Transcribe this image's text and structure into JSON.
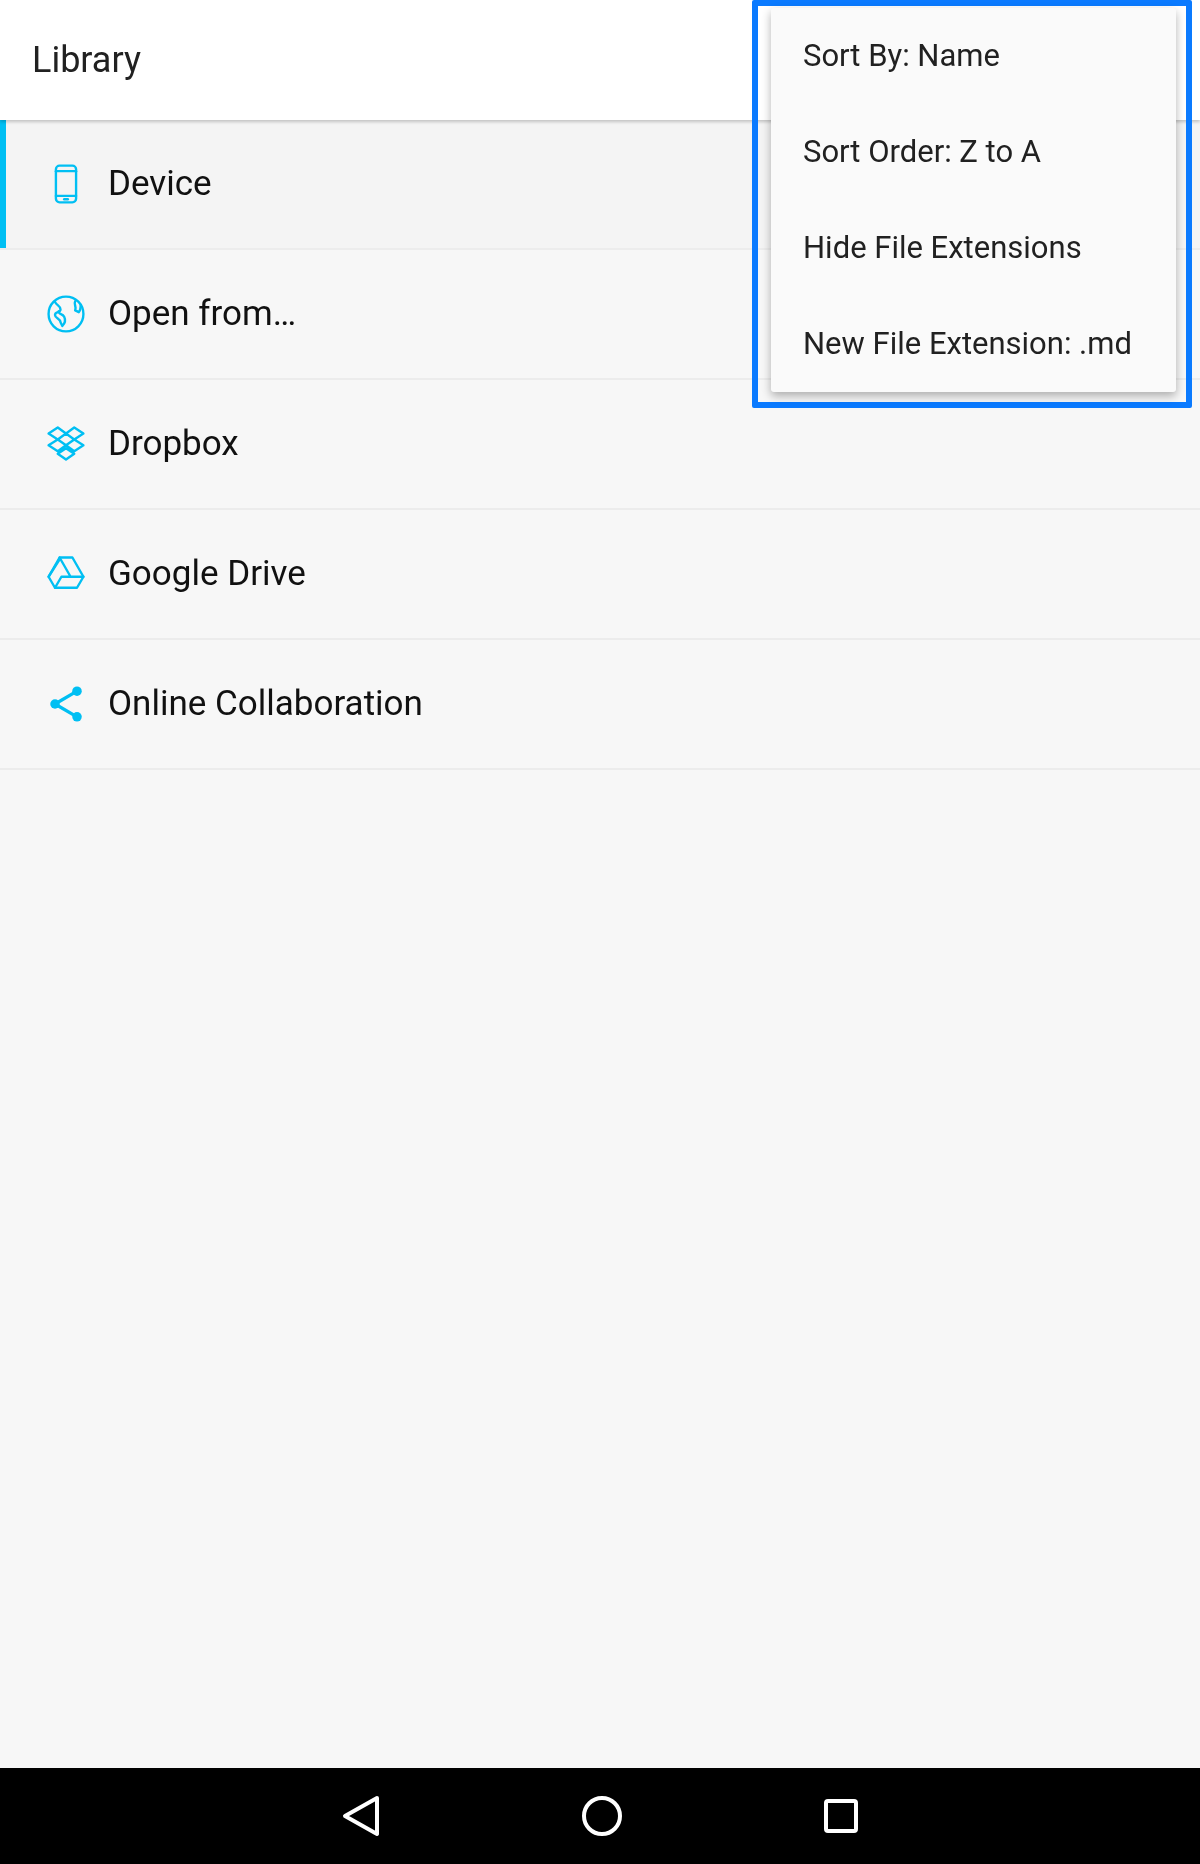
{
  "app_bar": {
    "title": "Library"
  },
  "sidebar": {
    "items": [
      {
        "label": "Device",
        "kind": "device",
        "selected": true
      },
      {
        "label": "Open from…",
        "kind": "globe",
        "selected": false
      },
      {
        "label": "Dropbox",
        "kind": "dropbox",
        "selected": false
      },
      {
        "label": "Google Drive",
        "kind": "drive",
        "selected": false
      },
      {
        "label": "Online Collaboration",
        "kind": "share",
        "selected": false
      }
    ]
  },
  "menu": {
    "highlighted": true,
    "items": [
      "Sort By: Name",
      "Sort Order: Z to A",
      "Hide File Extensions",
      "New File Extension: .md"
    ]
  }
}
